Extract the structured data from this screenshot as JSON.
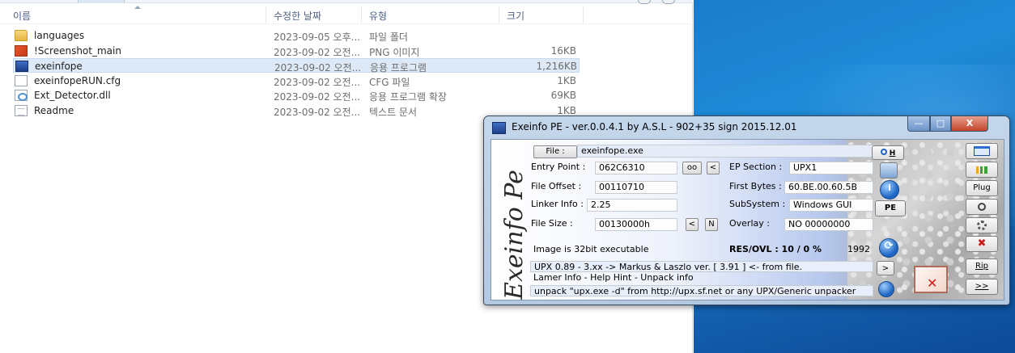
{
  "explorer": {
    "columns": {
      "name": "이름",
      "date": "수정한 날짜",
      "type": "유형",
      "size": "크기"
    },
    "files": [
      {
        "name": "languages",
        "date": "2023-09-05 오후...",
        "type": "파일 폴더",
        "size": "",
        "icon": "folder-icon"
      },
      {
        "name": "!Screenshot_main",
        "date": "2023-09-02 오전...",
        "type": "PNG 이미지",
        "size": "16KB",
        "icon": "png-file-icon"
      },
      {
        "name": "exeinfope",
        "date": "2023-09-02 오전...",
        "type": "응용 프로그램",
        "size": "1,216KB",
        "icon": "exe-file-icon",
        "selected": true
      },
      {
        "name": "exeinfopeRUN.cfg",
        "date": "2023-09-02 오전...",
        "type": "CFG 파일",
        "size": "1KB",
        "icon": "cfg-file-icon"
      },
      {
        "name": "Ext_Detector.dll",
        "date": "2023-09-02 오전...",
        "type": "응용 프로그램 확장",
        "size": "69KB",
        "icon": "dll-file-icon"
      },
      {
        "name": "Readme",
        "date": "2023-09-02 오전...",
        "type": "텍스트 문서",
        "size": "1KB",
        "icon": "text-file-icon"
      }
    ]
  },
  "exeinfo": {
    "title": "Exeinfo PE - ver.0.0.4.1  by A.S.L -  902+35 sign  2015.12.01",
    "caption_buttons": {
      "minimize": "—",
      "maximize": "□",
      "close": "X"
    },
    "signature": "Exeinfo Pe",
    "file_button": "File :",
    "file_name": "exeinfope.exe",
    "entry_point_label": "Entry Point :",
    "entry_point": "062C6310",
    "oo_button": "oo",
    "lt_button": "<",
    "ep_section_label": "EP Section :",
    "ep_section": "UPX1",
    "file_offset_label": "File Offset :",
    "file_offset": "00110710",
    "first_bytes_label": "First Bytes :",
    "first_bytes": "60.BE.00.60.5B",
    "linker_info_label": "Linker Info :",
    "linker_info": "2.25",
    "subsystem_label": "SubSystem :",
    "subsystem": "Windows GUI",
    "file_size_label": "File Size :",
    "file_size": "00130000h",
    "n_button": "N",
    "overlay_label": "Overlay :",
    "overlay": "NO  00000000",
    "image_info": "Image is 32bit executable",
    "res_ovl": "RES/OVL : 10 / 0 %",
    "year": "1992",
    "scan_result": "UPX 0.89 - 3.xx -> Markus & Laszlo ver. [ 3.91 ] <- from file.",
    "hint_line": "Lamer Info - Help Hint - Unpack info",
    "unpack_info": "unpack \"upx.exe -d\"  from  http://upx.sf.net or any UPX/Generic unpacker",
    "right_buttons": {
      "h": "H",
      "pe": "PE",
      "plug": "Plug",
      "rip": "Rip",
      "next": ">>",
      "arrow": ">"
    }
  }
}
